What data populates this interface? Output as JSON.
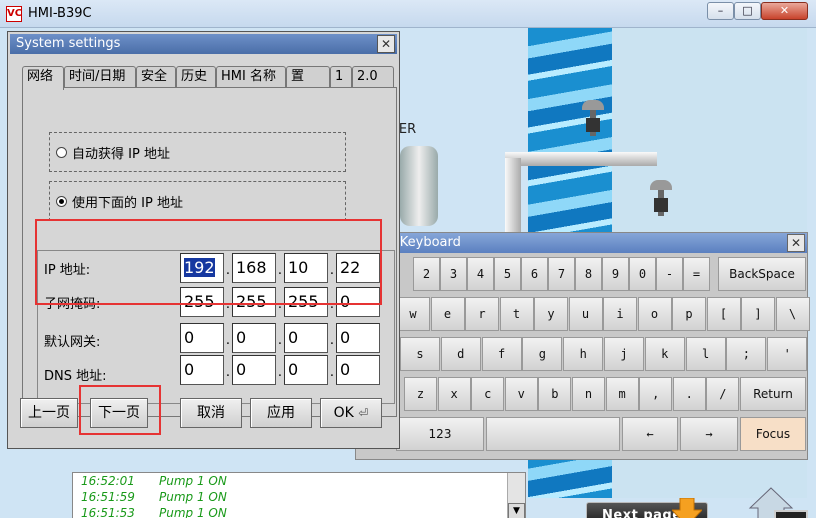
{
  "window": {
    "title": "HMI-B39C",
    "logo": "VC",
    "min": "–",
    "max": "□",
    "close": "✕"
  },
  "hmi": {
    "mixer_label": "XER",
    "log": [
      {
        "time": "16:52:01",
        "msg": "Pump 1 ON"
      },
      {
        "time": "16:51:59",
        "msg": "Pump 1 ON"
      },
      {
        "time": "16:51:53",
        "msg": "Pump 1 ON"
      }
    ],
    "next_page": "Next page"
  },
  "keyboard": {
    "title": "l Keyboard",
    "close": "✕",
    "row1": [
      "2",
      "3",
      "4",
      "5",
      "6",
      "7",
      "8",
      "9",
      "0",
      "-",
      "="
    ],
    "backspace": "BackSpace",
    "row2": [
      "w",
      "e",
      "r",
      "t",
      "y",
      "u",
      "i",
      "o",
      "p",
      "[",
      "]",
      "\\"
    ],
    "row3": [
      "s",
      "d",
      "f",
      "g",
      "h",
      "j",
      "k",
      "l",
      ";",
      "'"
    ],
    "return": "Return",
    "row4": [
      "z",
      "x",
      "c",
      "v",
      "b",
      "n",
      "m",
      ",",
      ".",
      "/"
    ],
    "num": "123",
    "left": "←",
    "right": "→",
    "focus": "Focus"
  },
  "dialog": {
    "title": "System settings",
    "close": "✕",
    "tabs": [
      "网络",
      "时间/日期",
      "安全",
      "历史",
      "HMI 名称",
      "置",
      "1",
      "2.0"
    ],
    "auto_ip": "自动获得 IP 地址",
    "manual_ip": "使用下面的 IP 地址",
    "ip_label": "IP 地址:",
    "mask_label": "子网掩码:",
    "gateway_label": "默认网关:",
    "dns_label": "DNS 地址:",
    "ip": [
      "192",
      "168",
      "10",
      "22"
    ],
    "mask": [
      "255",
      "255",
      "255",
      "0"
    ],
    "gateway": [
      "0",
      "0",
      "0",
      "0"
    ],
    "dns": [
      "0",
      "0",
      "0",
      "0"
    ],
    "buttons": {
      "prev": "上一页",
      "next": "下一页",
      "cancel": "取消",
      "apply": "应用",
      "ok": "OK"
    }
  }
}
